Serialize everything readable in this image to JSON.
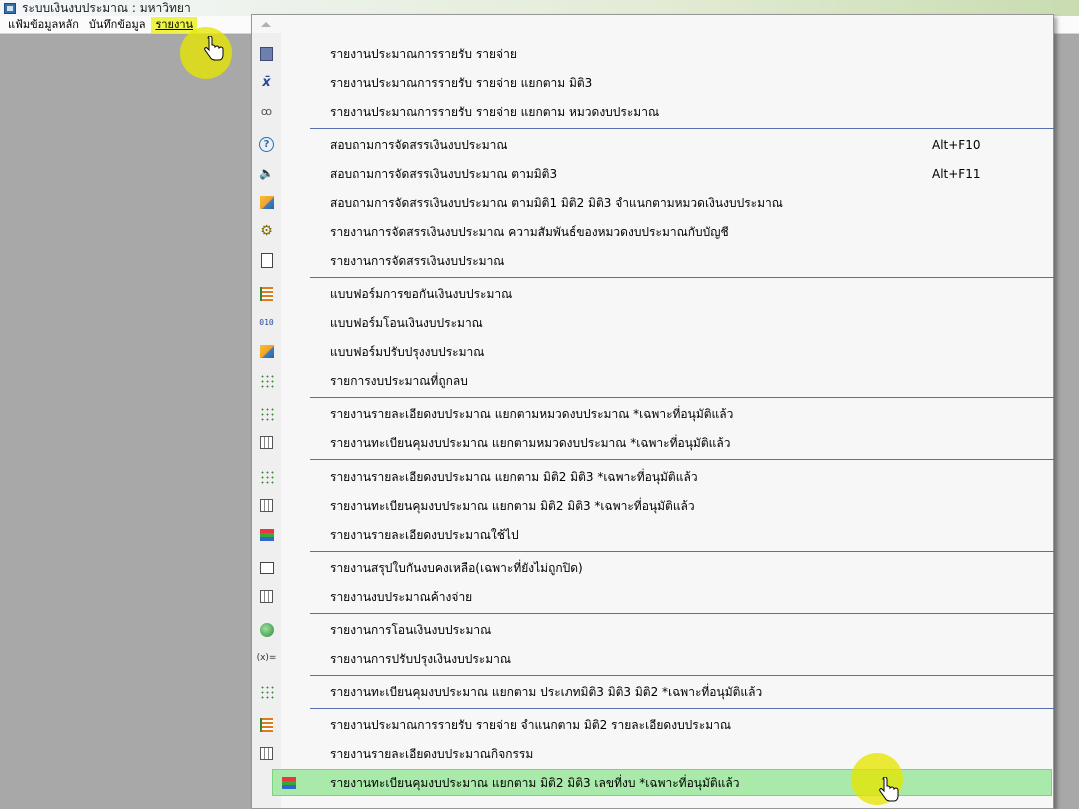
{
  "window": {
    "title": "ระบบเงินงบประมาณ : มหาวิทยา"
  },
  "menubar": {
    "items": [
      {
        "label": "แฟ้มข้อมูลหลัก"
      },
      {
        "label": "บันทึกข้อมูล"
      },
      {
        "label": "รายงาน"
      }
    ]
  },
  "report_menu": {
    "items": [
      {
        "label": "รายงานประมาณการรายรับ รายจ่าย",
        "shortcut": "",
        "icon": "film-icon"
      },
      {
        "label": "รายงานประมาณการรายรับ รายจ่าย แยกตาม มิติ3",
        "shortcut": "",
        "icon": "formula-icon"
      },
      {
        "label": "รายงานประมาณการรายรับ รายจ่าย แยกตาม หมวดงบประมาณ",
        "shortcut": "",
        "icon": "glasses-icon"
      },
      {
        "label": "สอบถามการจัดสรรเงินงบประมาณ",
        "shortcut": "Alt+F10",
        "icon": "question-icon"
      },
      {
        "label": "สอบถามการจัดสรรเงินงบประมาณ ตามมิติ3",
        "shortcut": "Alt+F11",
        "icon": "speaker-icon"
      },
      {
        "label": "สอบถามการจัดสรรเงินงบประมาณ  ตามมิติ1  มิติ2  มิติ3  จำแนกตามหมวดเงินงบประมาณ",
        "shortcut": "",
        "icon": "box-icon"
      },
      {
        "label": "รายงานการจัดสรรเงินงบประมาณ  ความสัมพันธ์ของหมวดงบประมาณกับบัญชี",
        "shortcut": "",
        "icon": "gear-face-icon"
      },
      {
        "label": "รายงานการจัดสรรเงินงบประมาณ",
        "shortcut": "",
        "icon": "document-icon"
      },
      {
        "label": "แบบฟอร์มการขอกันเงินงบประมาณ",
        "shortcut": "",
        "icon": "list-icon"
      },
      {
        "label": "แบบฟอร์มโอนเงินงบประมาณ",
        "shortcut": "",
        "icon": "binary-icon"
      },
      {
        "label": "แบบฟอร์มปรับปรุงงบประมาณ",
        "shortcut": "",
        "icon": "box-icon"
      },
      {
        "label": "รายการงบประมาณที่ถูกลบ",
        "shortcut": "",
        "icon": "dots-icon"
      },
      {
        "label": "รายงานรายละเอียดงบประมาณ  แยกตามหมวดงบประมาณ  *เฉพาะที่อนุมัติแล้ว",
        "shortcut": "",
        "icon": "dots-icon"
      },
      {
        "label": "รายงานทะเบียนคุมงบประมาณ  แยกตามหมวดงบประมาณ  *เฉพาะที่อนุมัติแล้ว",
        "shortcut": "",
        "icon": "sheet-icon"
      },
      {
        "label": "รายงานรายละเอียดงบประมาณ แยกตาม มิติ2 มิติ3 *เฉพาะที่อนุมัติแล้ว",
        "shortcut": "",
        "icon": "dots-icon"
      },
      {
        "label": "รายงานทะเบียนคุมงบประมาณ แยกตาม มิติ2 มิติ3 *เฉพาะที่อนุมัติแล้ว",
        "shortcut": "",
        "icon": "sheet-icon"
      },
      {
        "label": "รายงานรายละเอียดงบประมาณใช้ไป",
        "shortcut": "",
        "icon": "stack-icon"
      },
      {
        "label": "รายงานสรุปใบกันงบคงเหลือ(เฉพาะที่ยังไม่ถูกปิด)",
        "shortcut": "",
        "icon": "window-icon"
      },
      {
        "label": "รายงานงบประมาณค้างจ่าย",
        "shortcut": "",
        "icon": "grid-icon"
      },
      {
        "label": "รายงานการโอนเงินงบประมาณ",
        "shortcut": "",
        "icon": "magnifier-icon"
      },
      {
        "label": "รายงานการปรับปรุงเงินงบประมาณ",
        "shortcut": "",
        "icon": "function-icon"
      },
      {
        "label": "รายงานทะเบียนคุมงบประมาณ แยกตาม  ประเภทมิติ3 มิติ3 มิติ2  *เฉพาะที่อนุมัติแล้ว",
        "shortcut": "",
        "icon": "dots-icon"
      },
      {
        "label": "รายงานประมาณการรายรับ รายจ่าย จำแนกตาม มิติ2 รายละเอียดงบประมาณ",
        "shortcut": "",
        "icon": "list-icon"
      },
      {
        "label": "รายงานรายละเอียดงบประมาณกิจกรรม",
        "shortcut": "",
        "icon": "grid-icon"
      },
      {
        "label": "รายงานทะเบียนคุมงบประมาณ แยกตาม  มิติ2 มิติ3 เลขที่งบ *เฉพาะที่อนุมัติแล้ว",
        "shortcut": "",
        "icon": "stack-icon"
      }
    ]
  },
  "colors": {
    "selected_row": "#a9eaaa",
    "active_menubar": "#eef34a",
    "highlight_circle": "#e6e600",
    "separator": "#5a6fb0",
    "workspace": "#a8a8a8"
  }
}
